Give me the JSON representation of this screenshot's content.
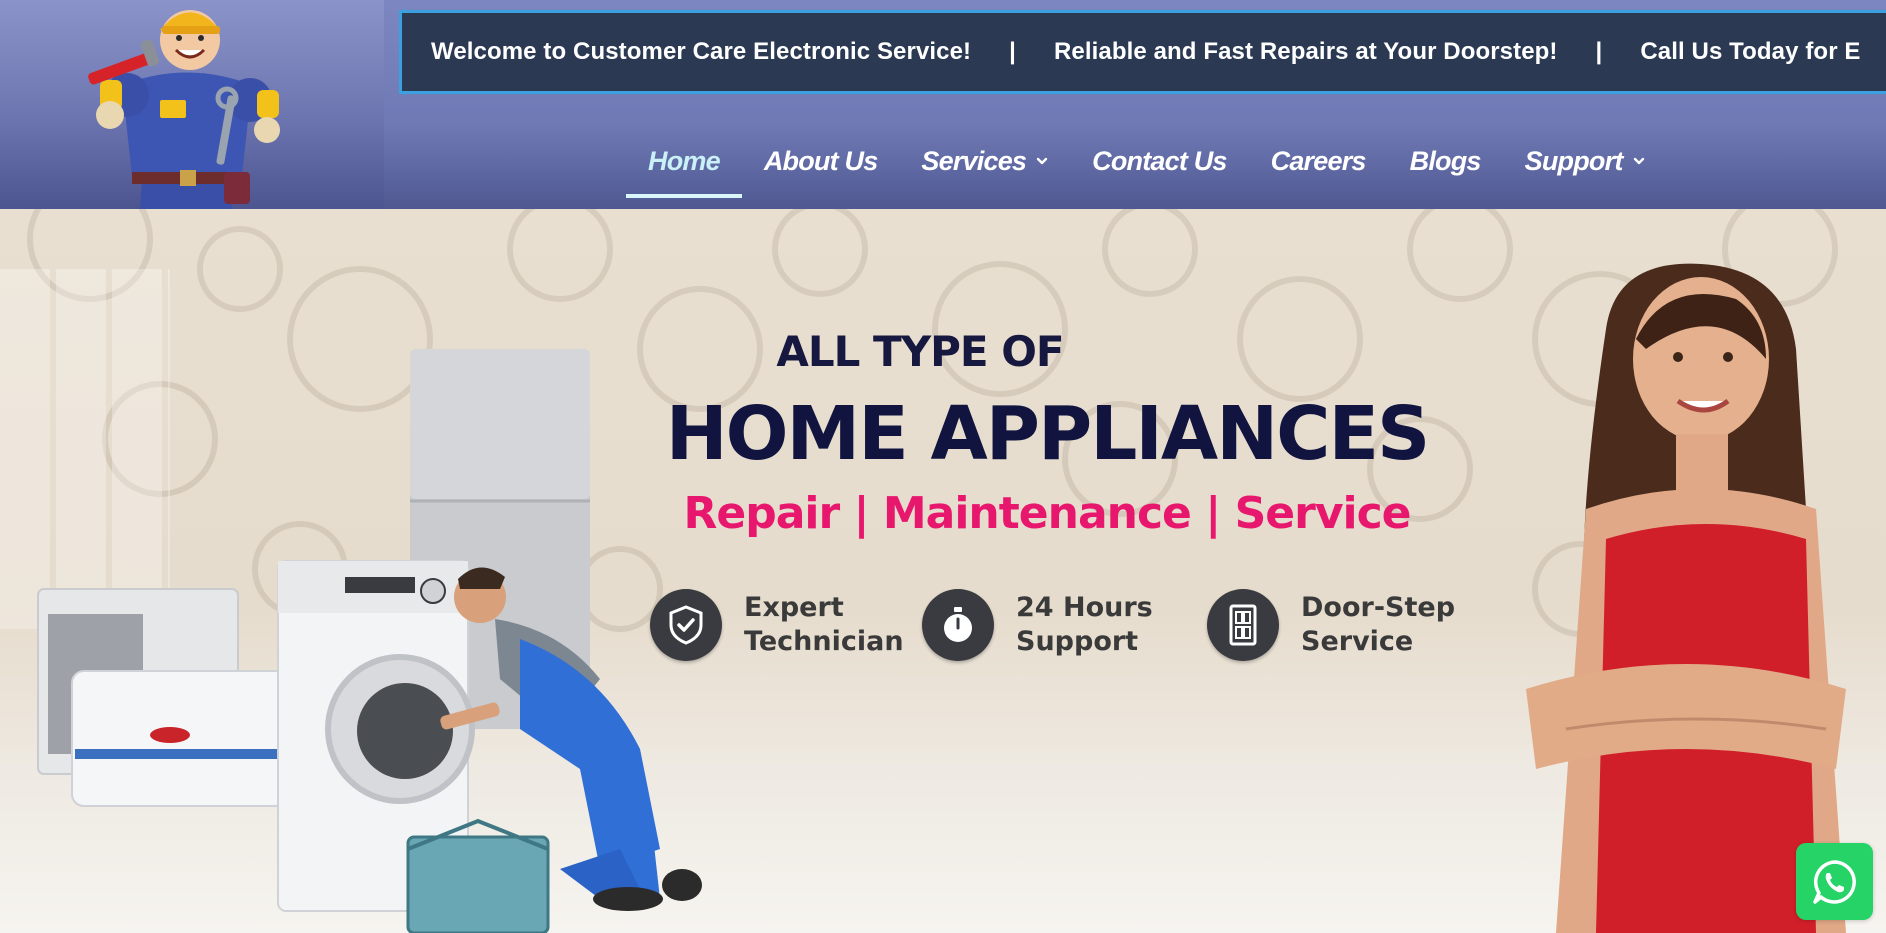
{
  "ticker": {
    "messages": [
      "Welcome to Customer Care Electronic Service!",
      "Reliable and Fast Repairs at Your Doorstep!",
      "Call Us Today for E"
    ],
    "separator": "|"
  },
  "nav": {
    "items": [
      {
        "label": "Home",
        "active": true,
        "dropdown": false
      },
      {
        "label": "About Us",
        "active": false,
        "dropdown": false
      },
      {
        "label": "Services",
        "active": false,
        "dropdown": true
      },
      {
        "label": "Contact Us",
        "active": false,
        "dropdown": false
      },
      {
        "label": "Careers",
        "active": false,
        "dropdown": false
      },
      {
        "label": "Blogs",
        "active": false,
        "dropdown": false
      },
      {
        "label": "Support",
        "active": false,
        "dropdown": true
      }
    ]
  },
  "hero": {
    "heading_small": "ALL TYPE OF",
    "heading_big": "HOME APPLIANCES",
    "subheading": "Repair | Maintenance | Service",
    "features": [
      {
        "icon": "shield-check-icon",
        "line1": "Expert",
        "line2": "Technician"
      },
      {
        "icon": "stopwatch-icon",
        "line1": "24 Hours",
        "line2": "Support"
      },
      {
        "icon": "door-icon",
        "line1": "Door-Step",
        "line2": "Service"
      }
    ]
  },
  "widgets": {
    "whatsapp_icon": "whatsapp-icon"
  },
  "colors": {
    "ticker_bg": "#2b3a52",
    "ticker_border": "#3aa0e0",
    "nav_bg": "#6f79b4",
    "heading": "#11143f",
    "accent_pink": "#e8176e",
    "whatsapp": "#25d366"
  }
}
